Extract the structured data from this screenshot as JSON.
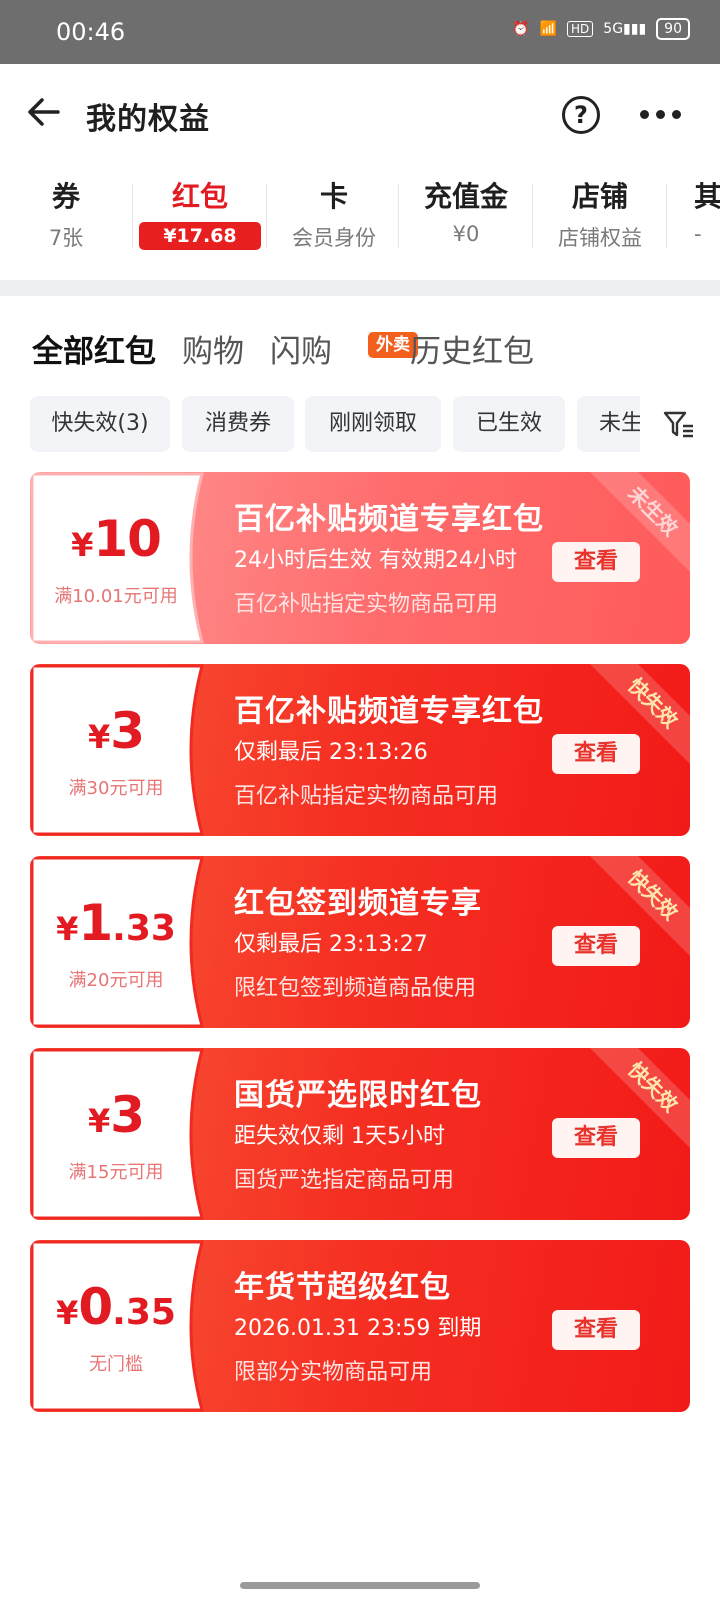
{
  "status": {
    "time": "00:46",
    "battery": "90"
  },
  "header": {
    "title": "我的权益"
  },
  "categories": [
    {
      "label": "券",
      "sub": "7张"
    },
    {
      "label": "红包",
      "sub": "¥17.68"
    },
    {
      "label": "卡",
      "sub": "会员身份"
    },
    {
      "label": "充值金",
      "sub": "¥0"
    },
    {
      "label": "店铺",
      "sub": "店铺权益"
    },
    {
      "label": "其",
      "sub": "-"
    }
  ],
  "tabs": [
    "全部红包",
    "购物",
    "闪购",
    "历史红包"
  ],
  "tab_badge": "外卖",
  "chips": [
    "快失效(3)",
    "消费券",
    "刚刚领取",
    "已生效",
    "未生"
  ],
  "coupons": [
    {
      "amount_int": "10",
      "amount_dec": "",
      "condition": "满10.01元可用",
      "name": "百亿补贴频道专享红包",
      "expiry": "24小时后生效 有效期24小时",
      "scope": "百亿补贴指定实物商品可用",
      "button": "查看",
      "ribbon": "未生效"
    },
    {
      "amount_int": "3",
      "amount_dec": "",
      "condition": "满30元可用",
      "name": "百亿补贴频道专享红包",
      "expiry": "仅剩最后 23:13:26",
      "scope": "百亿补贴指定实物商品可用",
      "button": "查看",
      "ribbon": "快失效"
    },
    {
      "amount_int": "1",
      "amount_dec": ".33",
      "condition": "满20元可用",
      "name": "红包签到频道专享",
      "expiry": "仅剩最后 23:13:27",
      "scope": "限红包签到频道商品使用",
      "button": "查看",
      "ribbon": "快失效"
    },
    {
      "amount_int": "3",
      "amount_dec": "",
      "condition": "满15元可用",
      "name": "国货严选限时红包",
      "expiry": "距失效仅剩 1天5小时",
      "scope": "国货严选指定商品可用",
      "button": "查看",
      "ribbon": "快失效"
    },
    {
      "amount_int": "0",
      "amount_dec": ".35",
      "condition": "无门槛",
      "name": "年货节超级红包",
      "expiry": "2026.01.31 23:59 到期",
      "scope": "限部分实物商品可用",
      "button": "查看",
      "ribbon": ""
    }
  ],
  "currency_symbol": "¥",
  "colors": {
    "accent": "#e21b23",
    "badge_orange": "#f3601d",
    "card_red": "#f4261c",
    "card_pink": "#ff7a7a"
  }
}
